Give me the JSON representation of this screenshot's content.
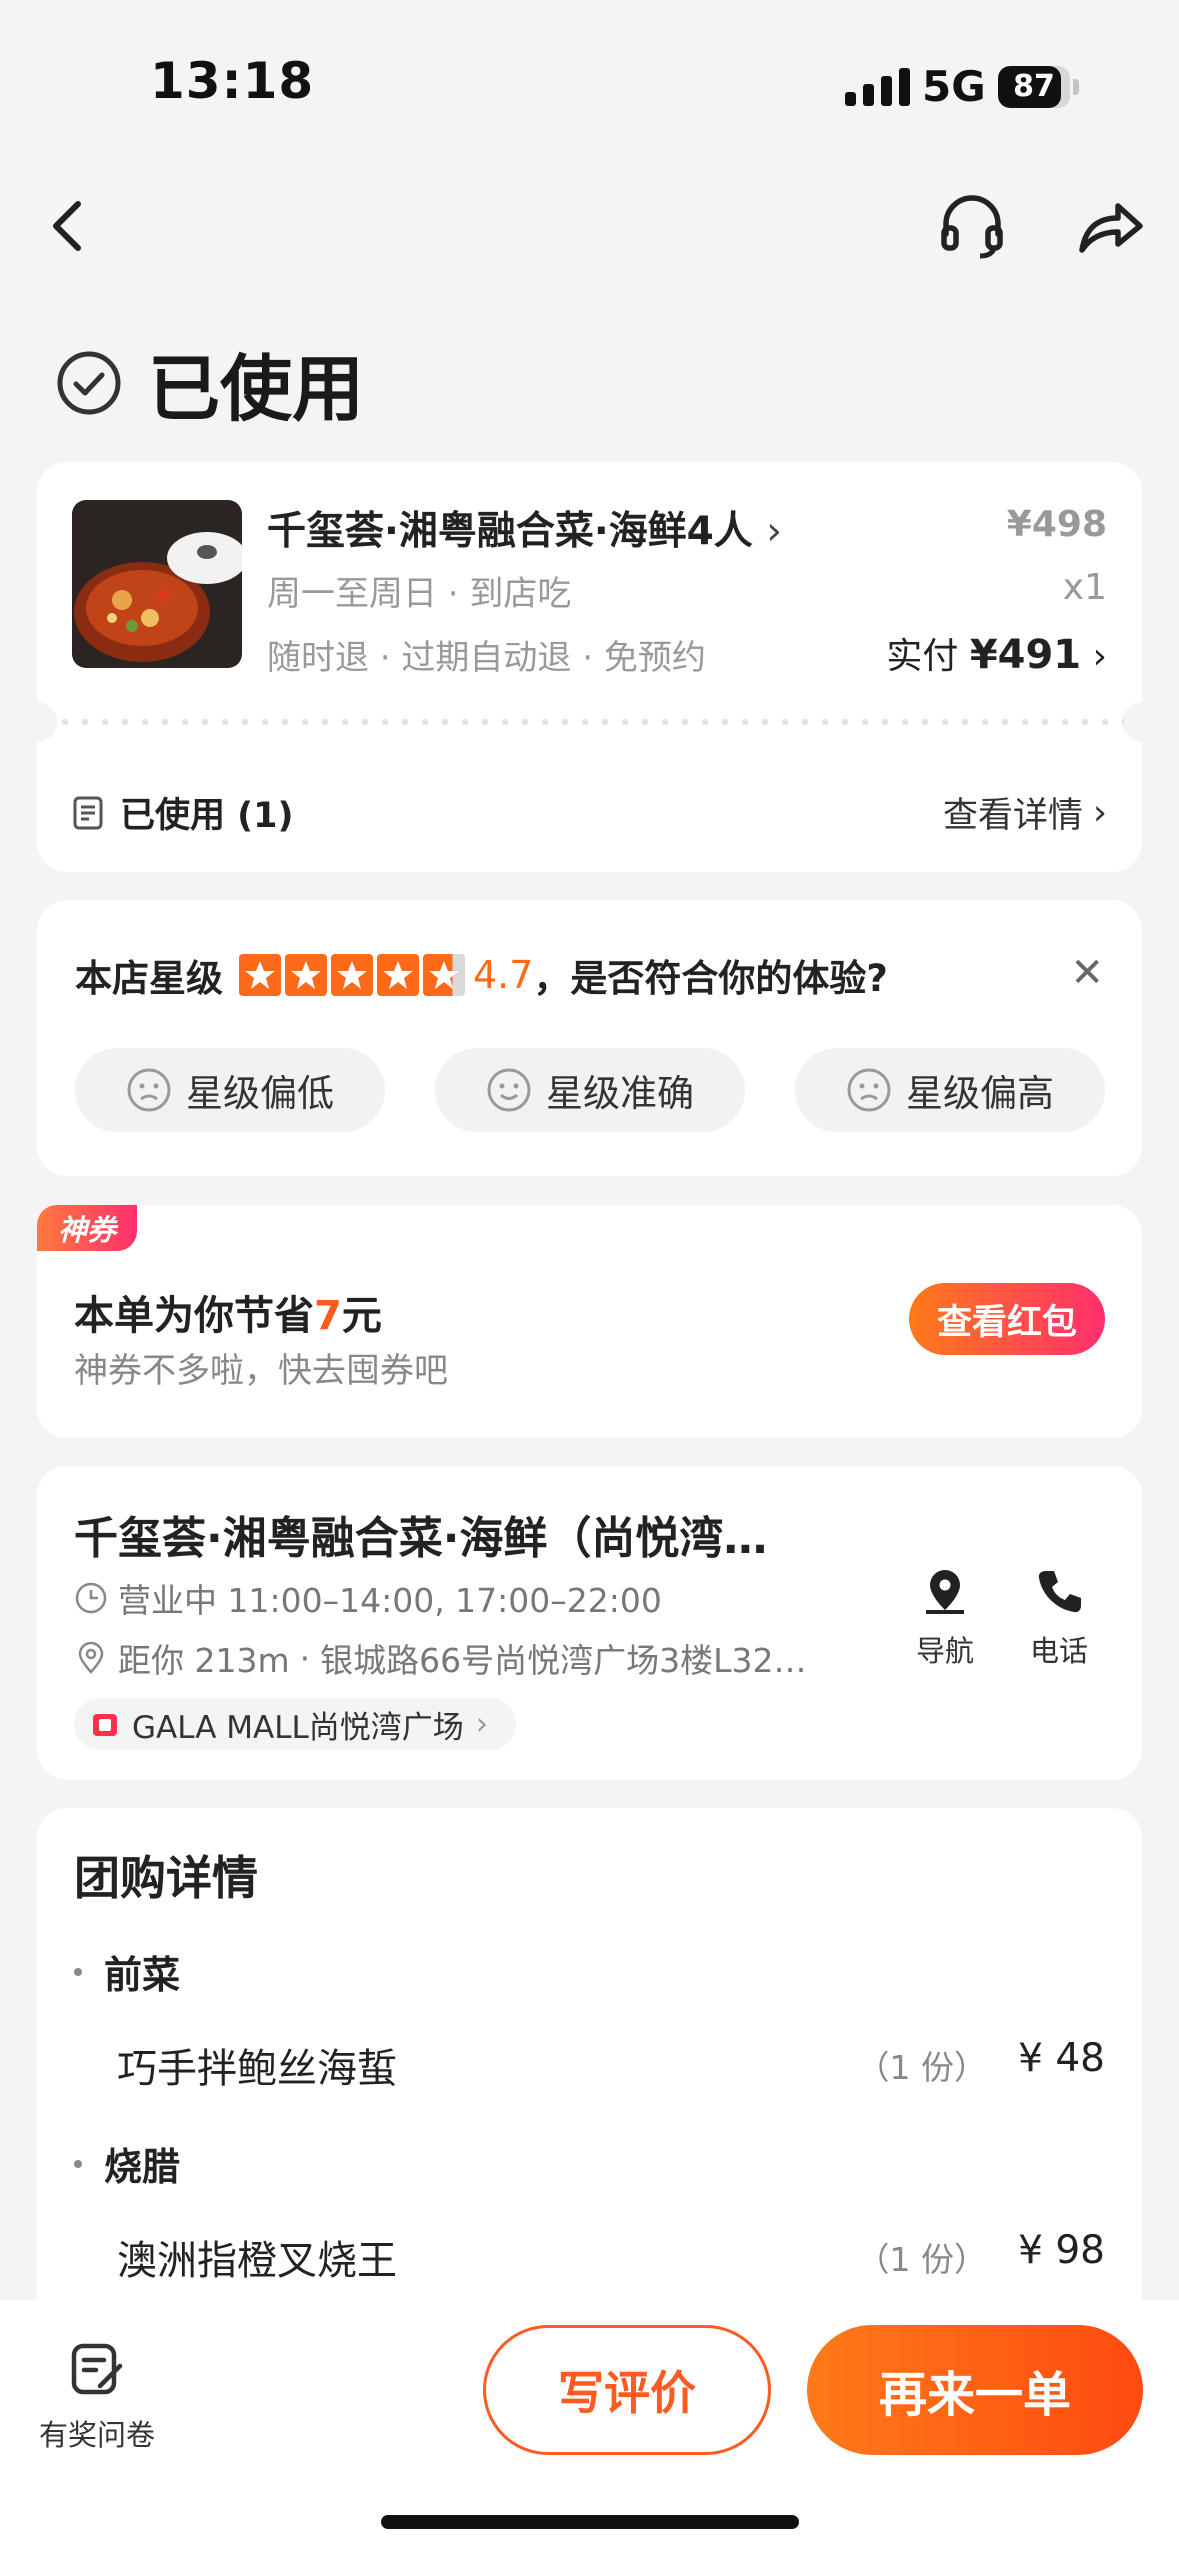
{
  "status_bar": {
    "time": "13:18",
    "network": "5G",
    "battery": "87",
    "battery_level": 0.87
  },
  "header": {
    "status_title": "已使用"
  },
  "order": {
    "name": "千玺荟·湘粤融合菜·海鲜4人",
    "sub1": "周一至周日 · 到店吃",
    "sub2": "随时退 · 过期自动退 · 免预约",
    "price": "¥498",
    "qty": "x1",
    "paid_label": "实付",
    "paid_value": "¥491",
    "used_label": "已使用 (1)",
    "detail_link": "查看详情"
  },
  "rating": {
    "label": "本店星级",
    "score": "4.7",
    "stars_value": 4.7,
    "question": "，是否符合你的体验?",
    "options": [
      "星级偏低",
      "星级准确",
      "星级偏高"
    ]
  },
  "coupon": {
    "tag": "神券",
    "save_prefix": "本单为你节省",
    "save_amount": "7",
    "save_suffix": "元",
    "subtitle": "神券不多啦，快去囤券吧",
    "button": "查看红包"
  },
  "shop": {
    "name": "千玺荟·湘粤融合菜·海鲜（尚悦湾…",
    "hours": "营业中 11:00–14:00, 17:00–22:00",
    "distance": "距你 213m",
    "address": "银城路66号尚悦湾广场3楼L32…",
    "mall": "GALA MALL尚悦湾广场",
    "nav_label": "导航",
    "phone_label": "电话"
  },
  "group_purchase": {
    "title": "团购详情",
    "categories": [
      {
        "name": "前菜",
        "items": [
          {
            "name": "巧手拌鲍丝海蜇",
            "qty": "（1 份）",
            "price": "¥ 48"
          }
        ]
      },
      {
        "name": "烧腊",
        "items": [
          {
            "name": "澳洲指橙叉烧王",
            "qty": "（1 份）",
            "price": "¥ 98"
          }
        ]
      }
    ]
  },
  "bottom": {
    "survey": "有奖问卷",
    "review": "写评价",
    "again": "再来一单"
  },
  "colors": {
    "accent": "#ff5a1f",
    "star": "#ff6a1a",
    "background": "#f4f4f4"
  }
}
